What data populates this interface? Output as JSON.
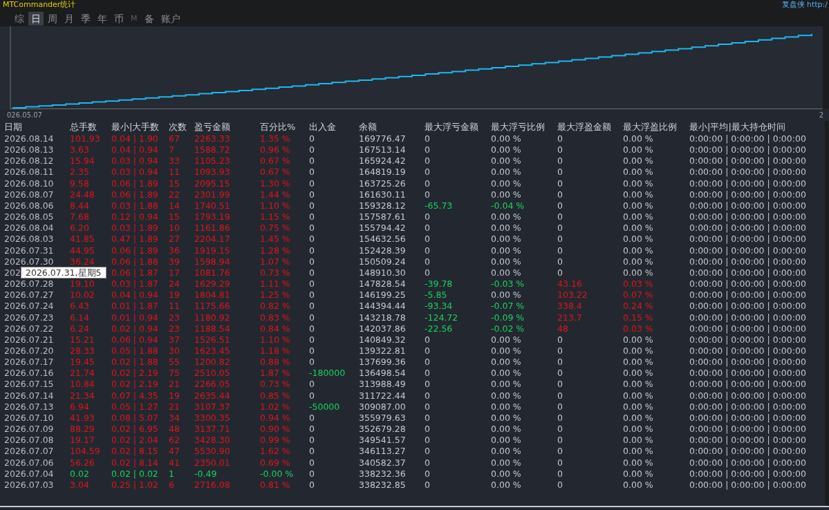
{
  "window": {
    "title": "MTCommander统计",
    "link": "复盘侠 http:/"
  },
  "tabs": [
    {
      "label": "综",
      "selected": false,
      "disabled": false
    },
    {
      "label": "日",
      "selected": true,
      "disabled": false
    },
    {
      "label": "周",
      "selected": false,
      "disabled": false
    },
    {
      "label": "月",
      "selected": false,
      "disabled": false
    },
    {
      "label": "季",
      "selected": false,
      "disabled": false
    },
    {
      "label": "年",
      "selected": false,
      "disabled": false
    },
    {
      "label": "币",
      "selected": false,
      "disabled": false
    },
    {
      "label": "M",
      "selected": false,
      "disabled": true
    },
    {
      "label": "备",
      "selected": false,
      "disabled": false
    },
    {
      "label": "账户",
      "selected": false,
      "disabled": false
    }
  ],
  "chart": {
    "x_start": "026.05.07",
    "x_end": "2"
  },
  "table": {
    "columns": [
      "日期",
      "总手数",
      "最小|大手数",
      "次数",
      "盈亏金额",
      "百分比%",
      "出入金",
      "余额",
      "最大浮亏金额",
      "最大浮亏比例",
      "最大浮盈金额",
      "最大浮盈比例",
      "最小|平均|最大持仓时间"
    ],
    "rows": [
      {
        "cells": [
          "2026.08.14",
          "101.93",
          "0.04 | 1.90",
          "67",
          "2263.33",
          "1.35 %",
          "0",
          "169776.47",
          "0",
          "0.00 %",
          "0",
          "0.00 %",
          "0:00:00 | 0:00:00 | 0:00:00"
        ],
        "loss_day": false,
        "cash_flow": false,
        "float_loss": false,
        "float_loss_pct": false,
        "float_profit": false
      },
      {
        "cells": [
          "2026.08.13",
          "3.63",
          "0.04 | 0.94",
          "7",
          "1588.72",
          "0.96 %",
          "0",
          "167513.14",
          "0",
          "0.00 %",
          "0",
          "0.00 %",
          "0:00:00 | 0:00:00 | 0:00:00"
        ],
        "loss_day": false,
        "cash_flow": false,
        "float_loss": false,
        "float_loss_pct": false,
        "float_profit": false
      },
      {
        "cells": [
          "2026.08.12",
          "15.94",
          "0.03 | 0.94",
          "33",
          "1105.23",
          "0.67 %",
          "0",
          "165924.42",
          "0",
          "0.00 %",
          "0",
          "0.00 %",
          "0:00:00 | 0:00:00 | 0:00:00"
        ],
        "loss_day": false,
        "cash_flow": false,
        "float_loss": false,
        "float_loss_pct": false,
        "float_profit": false
      },
      {
        "cells": [
          "2026.08.11",
          "2.35",
          "0.03 | 0.94",
          "11",
          "1093.93",
          "0.67 %",
          "0",
          "164819.19",
          "0",
          "0.00 %",
          "0",
          "0.00 %",
          "0:00:00 | 0:00:00 | 0:00:00"
        ],
        "loss_day": false,
        "cash_flow": false,
        "float_loss": false,
        "float_loss_pct": false,
        "float_profit": false
      },
      {
        "cells": [
          "2026.08.10",
          "9.58",
          "0.06 | 1.89",
          "15",
          "2095.15",
          "1.30 %",
          "0",
          "163725.26",
          "0",
          "0.00 %",
          "0",
          "0.00 %",
          "0:00:00 | 0:00:00 | 0:00:00"
        ],
        "loss_day": false,
        "cash_flow": false,
        "float_loss": false,
        "float_loss_pct": false,
        "float_profit": false
      },
      {
        "cells": [
          "2026.08.07",
          "24.48",
          "0.06 | 1.89",
          "22",
          "2301.99",
          "1.44 %",
          "0",
          "161630.11",
          "0",
          "0.00 %",
          "0",
          "0.00 %",
          "0:00:00 | 0:00:00 | 0:00:00"
        ],
        "loss_day": false,
        "cash_flow": false,
        "float_loss": false,
        "float_loss_pct": false,
        "float_profit": false
      },
      {
        "cells": [
          "2026.08.06",
          "8.44",
          "0.03 | 1.88",
          "14",
          "1740.51",
          "1.10 %",
          "0",
          "159328.12",
          "-65.73",
          "-0.04 %",
          "0",
          "0.00 %",
          "0:00:00 | 0:00:00 | 0:00:00"
        ],
        "loss_day": false,
        "cash_flow": false,
        "float_loss": true,
        "float_loss_pct": true,
        "float_profit": false
      },
      {
        "cells": [
          "2026.08.05",
          "7.68",
          "0.12 | 0.94",
          "15",
          "1793.19",
          "1.15 %",
          "0",
          "157587.61",
          "0",
          "0.00 %",
          "0",
          "0.00 %",
          "0:00:00 | 0:00:00 | 0:00:00"
        ],
        "loss_day": false,
        "cash_flow": false,
        "float_loss": false,
        "float_loss_pct": false,
        "float_profit": false
      },
      {
        "cells": [
          "2026.08.04",
          "6.20",
          "0.03 | 1.89",
          "10",
          "1161.86",
          "0.75 %",
          "0",
          "155794.42",
          "0",
          "0.00 %",
          "0",
          "0.00 %",
          "0:00:00 | 0:00:00 | 0:00:00"
        ],
        "loss_day": false,
        "cash_flow": false,
        "float_loss": false,
        "float_loss_pct": false,
        "float_profit": false
      },
      {
        "cells": [
          "2026.08.03",
          "41.85",
          "0.47 | 1.89",
          "27",
          "2204.17",
          "1.45 %",
          "0",
          "154632.56",
          "0",
          "0.00 %",
          "0",
          "0.00 %",
          "0:00:00 | 0:00:00 | 0:00:00"
        ],
        "loss_day": false,
        "cash_flow": false,
        "float_loss": false,
        "float_loss_pct": false,
        "float_profit": false
      },
      {
        "cells": [
          "2026.07.31",
          "44.95",
          "0.06 | 1.89",
          "36",
          "1919.15",
          "1.28 %",
          "0",
          "152428.39",
          "0",
          "0.00 %",
          "0",
          "0.00 %",
          "0:00:00 | 0:00:00 | 0:00:00"
        ],
        "loss_day": false,
        "cash_flow": false,
        "float_loss": false,
        "float_loss_pct": false,
        "float_profit": false
      },
      {
        "cells": [
          "2026.07.30",
          "36.24",
          "0.06 | 1.88",
          "39",
          "1598.94",
          "1.07 %",
          "0",
          "150509.24",
          "0",
          "0.00 %",
          "0",
          "0.00 %",
          "0:00:00 | 0:00:00 | 0:00:00"
        ],
        "loss_day": false,
        "cash_flow": false,
        "float_loss": false,
        "float_loss_pct": false,
        "float_profit": false
      },
      {
        "cells": [
          "202",
          null,
          "0.06 | 1.87",
          "17",
          "1081.76",
          "0.73 %",
          "0",
          "148910.30",
          "0",
          "0.00 %",
          "0",
          "0.00 %",
          "0:00:00 | 0:00:00 | 0:00:00"
        ],
        "loss_day": false,
        "cash_flow": false,
        "float_loss": false,
        "float_loss_pct": false,
        "float_profit": false
      },
      {
        "cells": [
          "2026.07.28",
          "19.10",
          "0.03 | 1.87",
          "24",
          "1629.29",
          "1.11 %",
          "0",
          "147828.54",
          "-39.78",
          "-0.03 %",
          "43.16",
          "0.03 %",
          "0:00:00 | 0:00:00 | 0:00:00"
        ],
        "loss_day": false,
        "cash_flow": false,
        "float_loss": true,
        "float_loss_pct": true,
        "float_profit": true
      },
      {
        "cells": [
          "2026.07.27",
          "10.02",
          "0.04 | 0.94",
          "19",
          "1804.81",
          "1.25 %",
          "0",
          "146199.25",
          "-5.85",
          "0.00 %",
          "103.22",
          "0.07 %",
          "0:00:00 | 0:00:00 | 0:00:00"
        ],
        "loss_day": false,
        "cash_flow": false,
        "float_loss": true,
        "float_loss_pct": false,
        "float_profit": true
      },
      {
        "cells": [
          "2026.07.24",
          "6.43",
          "0.01 | 1.87",
          "11",
          "1175.66",
          "0.82 %",
          "0",
          "144394.44",
          "-93.34",
          "-0.07 %",
          "338.4",
          "0.24 %",
          "0:00:00 | 0:00:00 | 0:00:00"
        ],
        "loss_day": false,
        "cash_flow": false,
        "float_loss": true,
        "float_loss_pct": true,
        "float_profit": true
      },
      {
        "cells": [
          "2026.07.23",
          "6.14",
          "0.01 | 0.94",
          "23",
          "1180.92",
          "0.83 %",
          "0",
          "143218.78",
          "-124.72",
          "-0.09 %",
          "213.7",
          "0.15 %",
          "0:00:00 | 0:00:00 | 0:00:00"
        ],
        "loss_day": false,
        "cash_flow": false,
        "float_loss": true,
        "float_loss_pct": true,
        "float_profit": true
      },
      {
        "cells": [
          "2026.07.22",
          "6.24",
          "0.02 | 0.94",
          "23",
          "1188.54",
          "0.84 %",
          "0",
          "142037.86",
          "-22.56",
          "-0.02 %",
          "48",
          "0.03 %",
          "0:00:00 | 0:00:00 | 0:00:00"
        ],
        "loss_day": false,
        "cash_flow": false,
        "float_loss": true,
        "float_loss_pct": true,
        "float_profit": true
      },
      {
        "cells": [
          "2026.07.21",
          "15.21",
          "0.06 | 0.94",
          "37",
          "1526.51",
          "1.10 %",
          "0",
          "140849.32",
          "0",
          "0.00 %",
          "0",
          "0.00 %",
          "0:00:00 | 0:00:00 | 0:00:00"
        ],
        "loss_day": false,
        "cash_flow": false,
        "float_loss": false,
        "float_loss_pct": false,
        "float_profit": false
      },
      {
        "cells": [
          "2026.07.20",
          "28.33",
          "0.05 | 1.88",
          "30",
          "1623.45",
          "1.18 %",
          "0",
          "139322.81",
          "0",
          "0.00 %",
          "0",
          "0.00 %",
          "0:00:00 | 0:00:00 | 0:00:00"
        ],
        "loss_day": false,
        "cash_flow": false,
        "float_loss": false,
        "float_loss_pct": false,
        "float_profit": false
      },
      {
        "cells": [
          "2026.07.17",
          "19.45",
          "0.02 | 1.88",
          "55",
          "1200.82",
          "0.88 %",
          "0",
          "137699.36",
          "0",
          "0.00 %",
          "0",
          "0.00 %",
          "0:00:00 | 0:00:00 | 0:00:00"
        ],
        "loss_day": false,
        "cash_flow": false,
        "float_loss": false,
        "float_loss_pct": false,
        "float_profit": false
      },
      {
        "cells": [
          "2026.07.16",
          "21.74",
          "0.02 | 2.19",
          "75",
          "2510.05",
          "1.87 %",
          "-180000",
          "136498.54",
          "0",
          "0.00 %",
          "0",
          "0.00 %",
          "0:00:00 | 0:00:00 | 0:00:00"
        ],
        "loss_day": false,
        "cash_flow": true,
        "float_loss": false,
        "float_loss_pct": false,
        "float_profit": false
      },
      {
        "cells": [
          "2026.07.15",
          "10.84",
          "0.02 | 2.19",
          "21",
          "2266.05",
          "0.73 %",
          "0",
          "313988.49",
          "0",
          "0.00 %",
          "0",
          "0.00 %",
          "0:00:00 | 0:00:00 | 0:00:00"
        ],
        "loss_day": false,
        "cash_flow": false,
        "float_loss": false,
        "float_loss_pct": false,
        "float_profit": false
      },
      {
        "cells": [
          "2026.07.14",
          "21.34",
          "0.07 | 4.35",
          "19",
          "2635.44",
          "0.85 %",
          "0",
          "311722.44",
          "0",
          "0.00 %",
          "0",
          "0.00 %",
          "0:00:00 | 0:00:00 | 0:00:00"
        ],
        "loss_day": false,
        "cash_flow": false,
        "float_loss": false,
        "float_loss_pct": false,
        "float_profit": false
      },
      {
        "cells": [
          "2026.07.13",
          "6.94",
          "0.05 | 1.27",
          "21",
          "3107.37",
          "1.02 %",
          "-50000",
          "309087.00",
          "0",
          "0.00 %",
          "0",
          "0.00 %",
          "0:00:00 | 0:00:00 | 0:00:00"
        ],
        "loss_day": false,
        "cash_flow": true,
        "float_loss": false,
        "float_loss_pct": false,
        "float_profit": false
      },
      {
        "cells": [
          "2026.07.10",
          "41.93",
          "0.08 | 5.07",
          "34",
          "3300.35",
          "0.94 %",
          "0",
          "355979.63",
          "0",
          "0.00 %",
          "0",
          "0.00 %",
          "0:00:00 | 0:00:00 | 0:00:00"
        ],
        "loss_day": false,
        "cash_flow": false,
        "float_loss": false,
        "float_loss_pct": false,
        "float_profit": false
      },
      {
        "cells": [
          "2026.07.09",
          "88.29",
          "0.02 | 6.95",
          "48",
          "3137.71",
          "0.90 %",
          "0",
          "352679.28",
          "0",
          "0.00 %",
          "0",
          "0.00 %",
          "0:00:00 | 0:00:00 | 0:00:00"
        ],
        "loss_day": false,
        "cash_flow": false,
        "float_loss": false,
        "float_loss_pct": false,
        "float_profit": false
      },
      {
        "cells": [
          "2026.07.08",
          "19.17",
          "0.02 | 2.04",
          "62",
          "3428.30",
          "0.99 %",
          "0",
          "349541.57",
          "0",
          "0.00 %",
          "0",
          "0.00 %",
          "0:00:00 | 0:00:00 | 0:00:00"
        ],
        "loss_day": false,
        "cash_flow": false,
        "float_loss": false,
        "float_loss_pct": false,
        "float_profit": false
      },
      {
        "cells": [
          "2026.07.07",
          "104.59",
          "0.02 | 8.15",
          "47",
          "5530.90",
          "1.62 %",
          "0",
          "346113.27",
          "0",
          "0.00 %",
          "0",
          "0.00 %",
          "0:00:00 | 0:00:00 | 0:00:00"
        ],
        "loss_day": false,
        "cash_flow": false,
        "float_loss": false,
        "float_loss_pct": false,
        "float_profit": false
      },
      {
        "cells": [
          "2026.07.06",
          "56.26",
          "0.02 | 8.14",
          "41",
          "2350.01",
          "0.69 %",
          "0",
          "340582.37",
          "0",
          "0.00 %",
          "0",
          "0.00 %",
          "0:00:00 | 0:00:00 | 0:00:00"
        ],
        "loss_day": false,
        "cash_flow": false,
        "float_loss": false,
        "float_loss_pct": false,
        "float_profit": false
      },
      {
        "cells": [
          "2026.07.04",
          "0.02",
          "0.02 | 0.02",
          "1",
          "-0.49",
          "-0.00 %",
          "0",
          "338232.36",
          "0",
          "0.00 %",
          "0",
          "0.00 %",
          "0:00:00 | 0:00:00 | 0:00:00"
        ],
        "loss_day": true,
        "cash_flow": false,
        "float_loss": false,
        "float_loss_pct": false,
        "float_profit": false
      },
      {
        "cells": [
          "2026.07.03",
          "3.04",
          "0.25 | 1.02",
          "6",
          "2716.08",
          "0.81 %",
          "0",
          "338232.85",
          "0",
          "0.00 %",
          "0",
          "0.00 %",
          "0:00:00 | 0:00:00 | 0:00:00"
        ],
        "loss_day": false,
        "cash_flow": false,
        "float_loss": false,
        "float_loss_pct": false,
        "float_profit": false
      }
    ]
  },
  "tooltip": {
    "text": "2026.07.31,星期5"
  }
}
